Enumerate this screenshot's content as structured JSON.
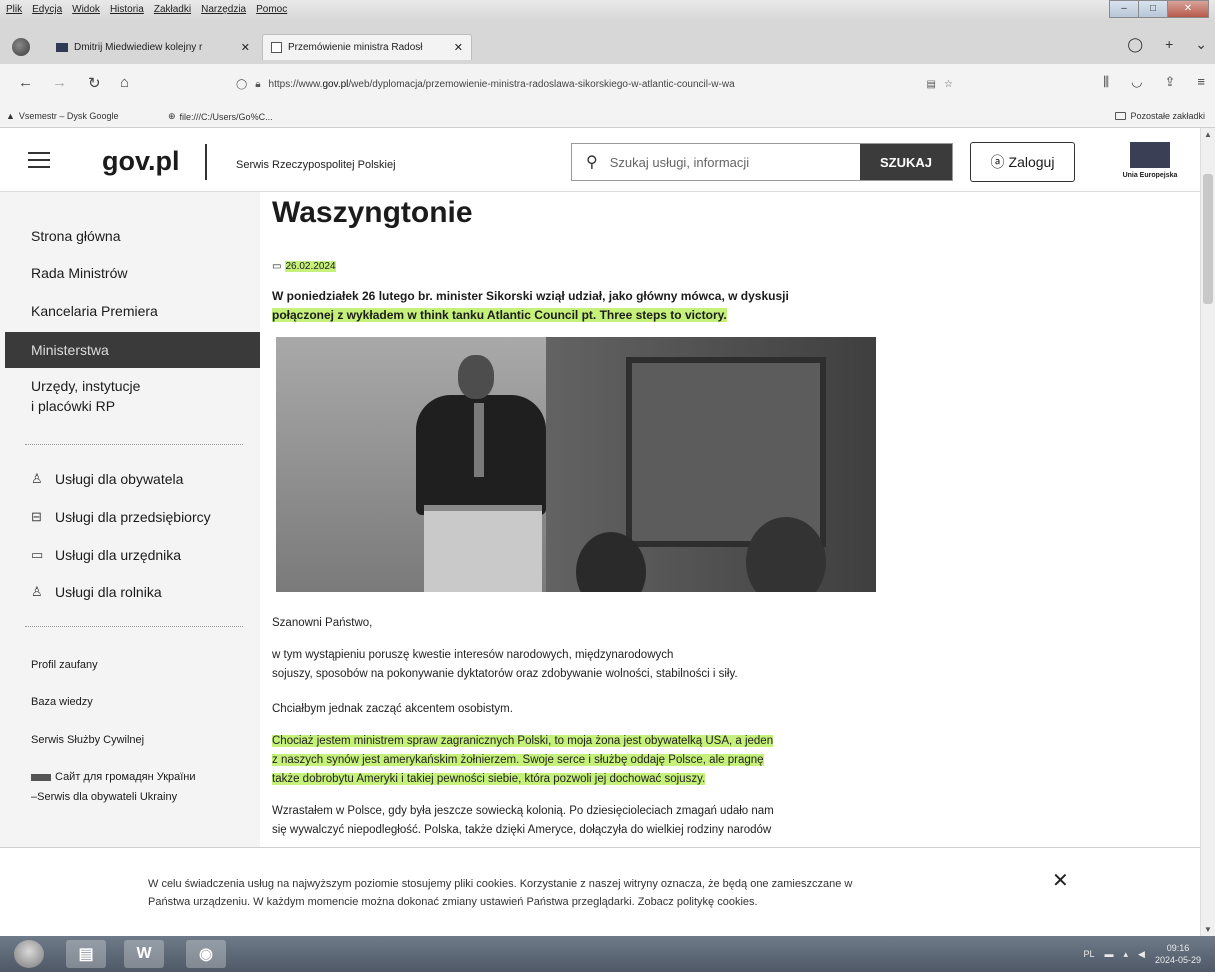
{
  "browser": {
    "menu": [
      "Plik",
      "Edycja",
      "Widok",
      "Historia",
      "Zakładki",
      "Narzędzia",
      "Pomoc"
    ],
    "tabs": [
      {
        "title": "Dmitrij Miedwiediew kolejny r",
        "active": false
      },
      {
        "title": "Przemówienie ministra Radosł",
        "active": true
      }
    ],
    "url_prefix": "https://www.",
    "url_domain": "gov.pl",
    "url_rest": "/web/dyplomacja/przemowienie-ministra-radoslawa-sikorskiego-w-atlantic-council-w-wa",
    "bookmarks": {
      "left1": "Vsemestr – Dysk Google",
      "left2": "file:///C:/Users/Go%C...",
      "right": "Pozostałe zakładki"
    }
  },
  "header": {
    "logo": "gov.pl",
    "service": "Serwis Rzeczypospolitej Polskiej",
    "search_placeholder": "Szukaj usługi, informacji",
    "search_button": "SZUKAJ",
    "login": "Zaloguj",
    "eu_label": "Unia Europejska"
  },
  "sidebar": {
    "main": [
      "Strona główna",
      "Rada Ministrów",
      "Kancelaria Premiera",
      "Ministerstwa",
      "Urzędy, instytucje",
      "i placówki RP"
    ],
    "services": [
      "Usługi dla obywatela",
      "Usługi dla przedsiębiorcy",
      "Usługi dla urzędnika",
      "Usługi dla rolnika"
    ],
    "extra": [
      "Profil zaufany",
      "Baza wiedzy",
      "Serwis Służby Cywilnej",
      "Сайт для громадян України",
      "–Serwis dla obywateli Ukrainy"
    ]
  },
  "article": {
    "title": "Waszyngtonie",
    "date": "26.02.2024",
    "lead_1": "W poniedziałek 26 lutego br. minister Sikorski wziął udział, jako główny mówca, w dyskusji",
    "lead_2": "połączonej z wykładem w think tanku Atlantic Council pt. Three steps to victory.",
    "p1": "Szanowni Państwo,",
    "p2_1": "w tym wystąpieniu poruszę kwestie interesów narodowych, międzynarodowych",
    "p2_2": "sojuszy, sposobów na pokonywanie dyktatorów oraz zdobywanie wolności, stabilności i siły.",
    "p3": "Chciałbym jednak zacząć akcentem osobistym.",
    "p4_1": "Chociaż jestem ministrem spraw zagranicznych Polski, to moja żona jest obywatelką USA, a jeden",
    "p4_2": "z naszych synów jest amerykańskim żołnierzem. Swoje serce i służbę oddaję Polsce, ale pragnę",
    "p4_3": "także dobrobytu Ameryki i takiej pewności siebie, która pozwoli jej dochować sojuszy.",
    "p5_1": "Wzrastałem w Polsce, gdy była jeszcze sowiecką kolonią. Po dziesięcioleciach zmagań udało nam",
    "p5_2": "się wywalczyć niepodległość. Polska, także dzięki Ameryce, dołączyła do wielkiej rodziny narodów"
  },
  "cookie": {
    "line1": "W celu świadczenia usług na najwyższym poziomie stosujemy pliki cookies. Korzystanie z naszej witryny oznacza, że będą one zamieszczane w",
    "line2": "Państwa urządzeniu. W każdym momencie można dokonać zmiany ustawień Państwa przeglądarki. Zobacz politykę cookies."
  },
  "taskbar": {
    "lang": "PL",
    "time": "09:16",
    "date": "2024-05-29"
  },
  "colors": {
    "highlight": "#c5f07a",
    "active_nav": "#3a3a3a"
  }
}
